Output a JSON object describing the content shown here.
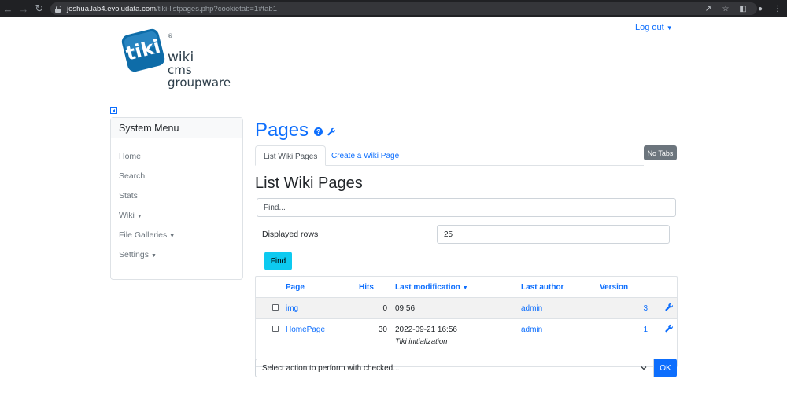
{
  "browser": {
    "url_host": "joshua.lab4.evoludata.com",
    "url_path": "/tiki-listpages.php?cookietab=1#tab1"
  },
  "logo": {
    "mark": "tiki",
    "line1": "wiki",
    "line2": "cms",
    "line3": "groupware",
    "registered": "®",
    "color": "#0e6ca8"
  },
  "header": {
    "logout_label": "Log out"
  },
  "sidebar": {
    "title": "System Menu",
    "items": [
      {
        "label": "Home"
      },
      {
        "label": "Search"
      },
      {
        "label": "Stats"
      },
      {
        "label": "Wiki"
      },
      {
        "label": "File Galleries"
      },
      {
        "label": "Settings"
      }
    ]
  },
  "main": {
    "page_title": "Pages",
    "help_glyph": "?",
    "tabs": [
      {
        "label": "List Wiki Pages"
      },
      {
        "label": "Create a Wiki Page"
      }
    ],
    "no_tabs_label": "No Tabs",
    "list_title": "List Wiki Pages",
    "find_placeholder": "Find...",
    "rows_label": "Displayed rows",
    "rows_value": "25",
    "find_button": "Find"
  },
  "table": {
    "headers": {
      "page": "Page",
      "hits": "Hits",
      "last_modification": "Last modification",
      "last_author": "Last author",
      "version": "Version"
    },
    "rows": [
      {
        "page": "img",
        "hits": "0",
        "modified": "09:56",
        "comment": "",
        "author": "admin",
        "version": "3"
      },
      {
        "page": "HomePage",
        "hits": "30",
        "modified": "2022-09-21 16:56",
        "comment": "Tiki initialization",
        "author": "admin",
        "version": "1"
      }
    ]
  },
  "footer_action": {
    "select_label": "Select action to perform with checked...",
    "ok_label": "OK"
  },
  "colors": {
    "link": "#0d6efd",
    "info_button": "#0dcaf0",
    "secondary": "#6c757d"
  }
}
